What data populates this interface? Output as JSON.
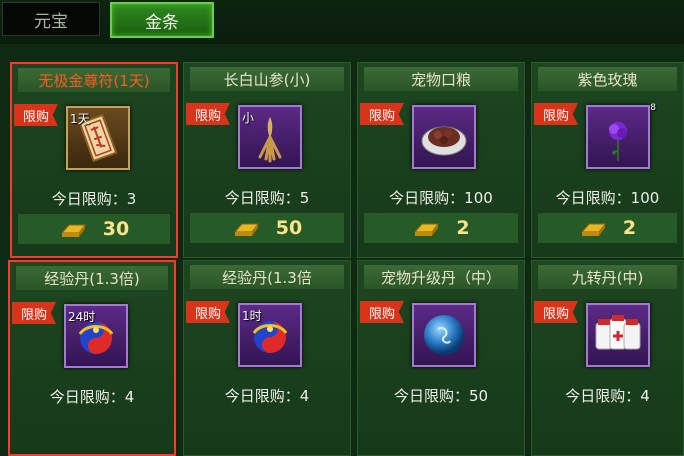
{
  "tabs": {
    "yuanbao": "元宝",
    "gold": "金条"
  },
  "ribbon_label": "限购",
  "items": [
    {
      "title": "无极金尊符(1天)",
      "tag": "1天",
      "limit": "今日限购：3",
      "price": "30",
      "icon": "talisman-icon"
    },
    {
      "title": "长白山参(小)",
      "tag": "小",
      "limit": "今日限购：5",
      "price": "50",
      "icon": "ginseng-icon"
    },
    {
      "title": "宠物口粮",
      "tag": "",
      "limit": "今日限购：100",
      "price": "2",
      "icon": "pet-food-icon"
    },
    {
      "title": "紫色玫瑰",
      "tag": "8",
      "limit": "今日限购：100",
      "price": "2",
      "icon": "purple-rose-icon"
    },
    {
      "title": "经验丹(1.3倍)",
      "tag": "24时",
      "limit": "今日限购：4",
      "price": "",
      "icon": "exp-pill-icon"
    },
    {
      "title": "经验丹(1.3倍",
      "tag": "1时",
      "limit": "今日限购：4",
      "price": "",
      "icon": "exp-pill-icon"
    },
    {
      "title": "宠物升级丹（中）",
      "tag": "",
      "limit": "今日限购：50",
      "price": "",
      "icon": "pet-upgrade-pill-icon"
    },
    {
      "title": "九转丹(中)",
      "tag": "",
      "limit": "今日限购：4",
      "price": "",
      "icon": "nine-turn-pill-icon"
    }
  ]
}
